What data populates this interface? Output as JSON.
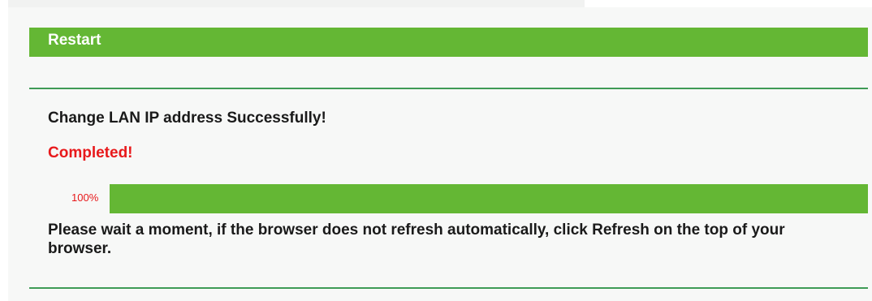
{
  "header": {
    "title": "Restart"
  },
  "main": {
    "success_message": "Change LAN IP address Successfully!",
    "status_message": "Completed!",
    "progress": {
      "label": "100%",
      "percent": 100
    },
    "instruction": "Please wait a moment, if the browser does not refresh automatically, click Refresh on the top of your browser."
  },
  "colors": {
    "accent_green": "#64b734",
    "divider_green": "#3f9b56",
    "status_red": "#e8191b",
    "text_dark": "#1a1a1a"
  }
}
